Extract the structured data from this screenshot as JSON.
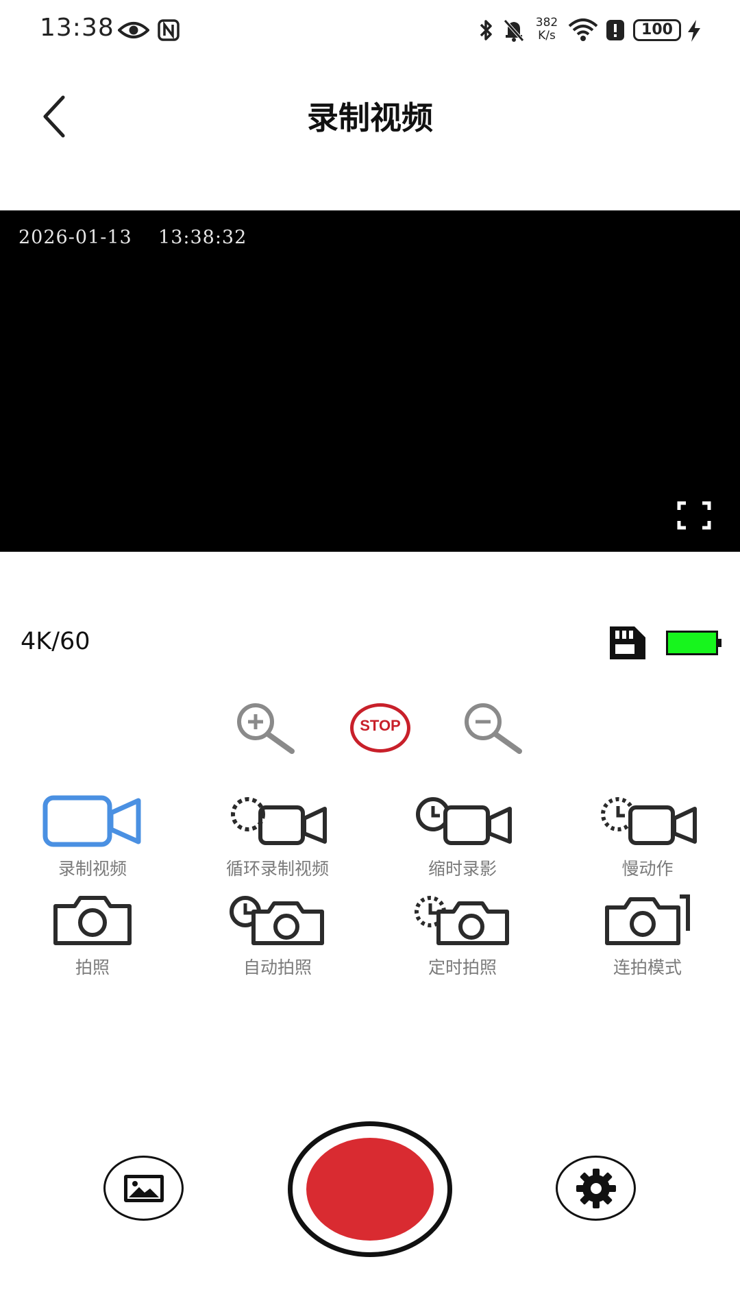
{
  "status_bar": {
    "time": "13:38",
    "net_speed_value": "382",
    "net_speed_unit": "K/s",
    "battery": "100",
    "icons": [
      "eye-icon",
      "nfc-icon",
      "bluetooth-icon",
      "bell-off-icon",
      "wifi-icon",
      "alert-icon",
      "charging-icon"
    ]
  },
  "header": {
    "title": "录制视频",
    "back_icon": "chevron-left-icon"
  },
  "preview": {
    "osd_date": "2026-01-13",
    "osd_time": "13:38:32",
    "fullscreen_icon": "fullscreen-icon"
  },
  "info": {
    "resolution": "4K/60",
    "sd_icon": "sd-card-icon",
    "battery_color": "#17f51d"
  },
  "controls": {
    "zoom_in_icon": "zoom-in-icon",
    "stop_label": "STOP",
    "zoom_out_icon": "zoom-out-icon"
  },
  "modes": [
    {
      "label": "录制视频",
      "icon": "video-camera-icon",
      "active": true
    },
    {
      "label": "循环录制视频",
      "icon": "loop-video-icon",
      "active": false
    },
    {
      "label": "缩时录影",
      "icon": "timelapse-video-icon",
      "active": false
    },
    {
      "label": "慢动作",
      "icon": "slow-motion-icon",
      "active": false
    },
    {
      "label": "拍照",
      "icon": "photo-camera-icon",
      "active": false
    },
    {
      "label": "自动拍照",
      "icon": "auto-photo-icon",
      "active": false
    },
    {
      "label": "定时拍照",
      "icon": "timer-photo-icon",
      "active": false
    },
    {
      "label": "连拍模式",
      "icon": "burst-photo-icon",
      "active": false
    }
  ],
  "bottom": {
    "gallery_icon": "gallery-icon",
    "record_icon": "record-icon",
    "settings_icon": "gear-icon"
  },
  "colors": {
    "active_blue": "#4a90e2",
    "record_red": "#d92b31",
    "stop_red": "#c8202a",
    "icon_dark": "#2b2b2b",
    "label_gray": "#7a7a7a"
  }
}
